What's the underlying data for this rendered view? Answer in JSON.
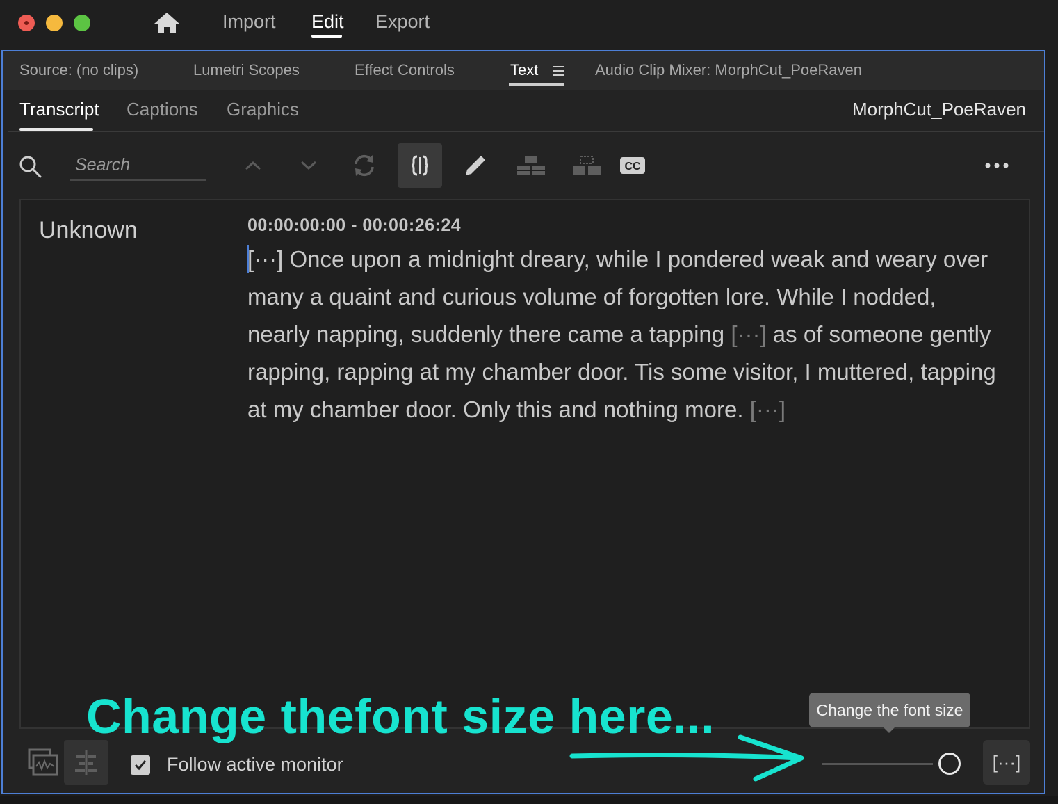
{
  "window": {
    "nav": {
      "import": "Import",
      "edit": "Edit",
      "export": "Export"
    }
  },
  "panel_tabs": {
    "source": "Source: (no clips)",
    "lumetri": "Lumetri Scopes",
    "effect_controls": "Effect Controls",
    "text": "Text",
    "audio_mixer": "Audio Clip Mixer: MorphCut_PoeRaven"
  },
  "sub_tabs": {
    "transcript": "Transcript",
    "captions": "Captions",
    "graphics": "Graphics",
    "sequence_name": "MorphCut_PoeRaven"
  },
  "search": {
    "placeholder": "Search"
  },
  "transcript": {
    "speaker": "Unknown",
    "timecode": "00:00:00:00 - 00:00:26:24",
    "pause_marker": "[···]",
    "segment1": " Once upon a midnight dreary, while I pondered weak and weary over many a quaint and curious volume of forgotten lore. While I nodded, nearly napping, suddenly there came a tapping ",
    "segment2": " as of someone gently rapping, rapping at my chamber door. Tis some visitor, I muttered, tapping at my chamber door. Only this and nothing more. "
  },
  "bottom": {
    "follow_label": "Follow active monitor",
    "follow_checked": true,
    "font_size_tooltip": "Change the font size",
    "pause_button": "[···]"
  },
  "annotation": {
    "text": "Change thefont size here..."
  },
  "colors": {
    "accent_blue": "#4d7fd6",
    "annotation": "#17e3cf",
    "panel_bg": "#232323"
  }
}
